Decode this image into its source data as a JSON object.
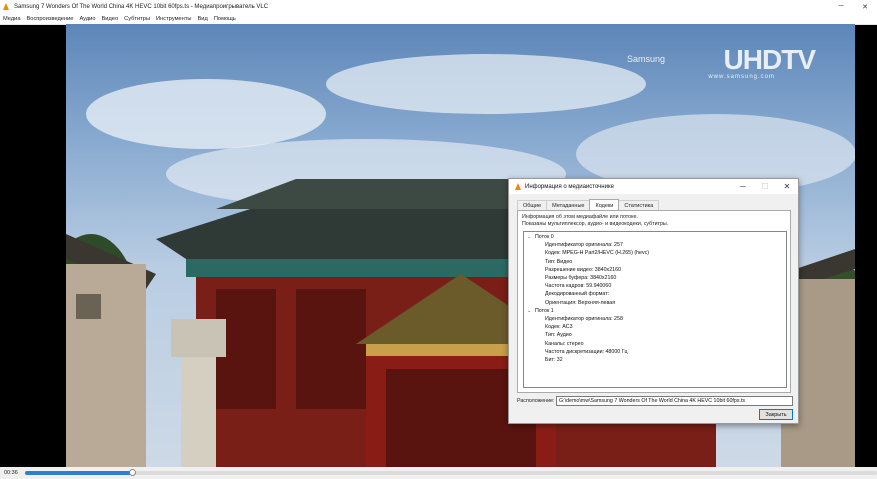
{
  "window": {
    "title": "Samsung 7 Wonders Of The World China 4K HEVC 10bit 60fps.ts - Медиапроигрыватель VLC",
    "minimize_icon": "minimize-icon",
    "close_icon": "close-icon"
  },
  "menu": [
    "Медиа",
    "Воспроизведение",
    "Аудио",
    "Видео",
    "Субтитры",
    "Инструменты",
    "Вид",
    "Помощь"
  ],
  "video": {
    "watermark_brand": "Samsung",
    "watermark_logo": "UHDTV",
    "watermark_site": "www.samsung.com"
  },
  "player": {
    "elapsed": "00:36",
    "progress": 0.126
  },
  "dialog": {
    "title": "Информация о медиаисточнике",
    "tabs": [
      {
        "label": "Общие",
        "active": false
      },
      {
        "label": "Метаданные",
        "active": false
      },
      {
        "label": "Кодеки",
        "active": true
      },
      {
        "label": "Статистика",
        "active": false
      }
    ],
    "description_line1": "Информация об этом медиафайле или потоке.",
    "description_line2": "Показаны мультиплексор, аудио- и видеокодеки, субтитры.",
    "streams": [
      {
        "label": "Поток 0",
        "props": [
          "Идентификатор оригинала: 257",
          "Кодек: MPEG-H Part2/HEVC (H.265) (hevc)",
          "Тип: Видео",
          "Разрешение видео: 3840x2160",
          "Размеры буфера: 3840x2160",
          "Частота кадров: 59.940060",
          "Декодированный формат:",
          "Ориентация: Верхняя-левая"
        ]
      },
      {
        "label": "Поток 1",
        "props": [
          "Идентификатор оригинала: 258",
          "Кодек: AC3",
          "Тип: Аудио",
          "Каналы: стерео",
          "Частота дискретизации: 48000 Гц",
          "Бит: 32"
        ]
      }
    ],
    "location_label": "Расположение:",
    "location_value": "G:\\demo\\mw\\Samsung 7 Wonders Of The World China 4K HEVC 10bit 60fps.ts",
    "close_label": "Закрыть",
    "cone_icon": "vlc-cone-icon"
  },
  "colors": {
    "accent": "#2b7fd4",
    "vlc_orange": "#f08a00"
  }
}
